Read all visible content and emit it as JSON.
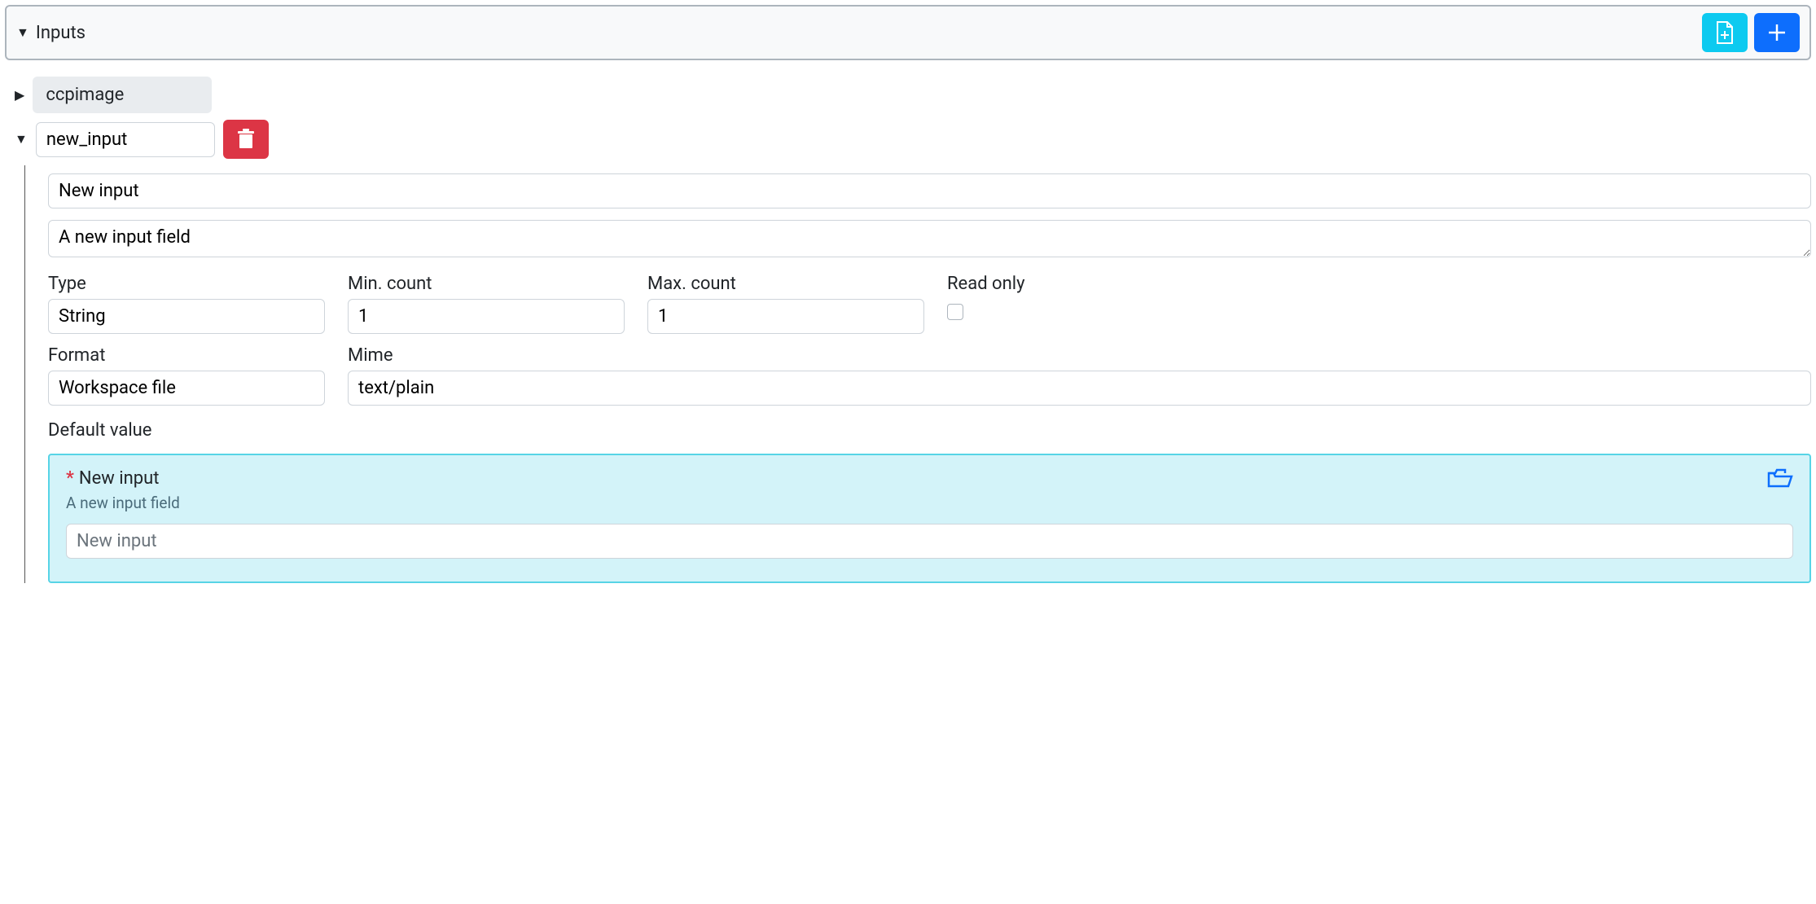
{
  "panel": {
    "title": "Inputs"
  },
  "items": {
    "collapsed": {
      "name": "ccpimage"
    },
    "expanded": {
      "name": "new_input",
      "title_field": "New input",
      "description_field": "A new input field",
      "type": {
        "label": "Type",
        "value": "String"
      },
      "min_count": {
        "label": "Min. count",
        "value": "1"
      },
      "max_count": {
        "label": "Max. count",
        "value": "1"
      },
      "read_only": {
        "label": "Read only",
        "checked": false
      },
      "format": {
        "label": "Format",
        "value": "Workspace file"
      },
      "mime": {
        "label": "Mime",
        "value": "text/plain"
      },
      "default": {
        "section_label": "Default value",
        "title": "New input",
        "subtitle": "A new input field",
        "placeholder": "New input"
      }
    }
  }
}
